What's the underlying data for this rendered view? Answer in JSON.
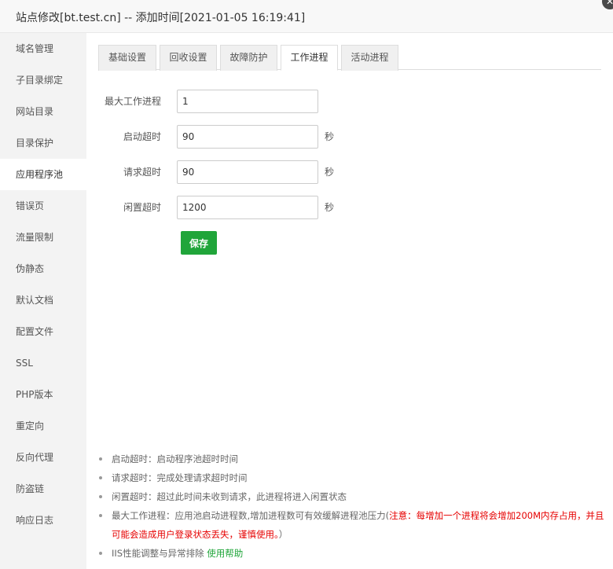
{
  "window": {
    "title": "站点修改[bt.test.cn] -- 添加时间[2021-01-05 16:19:41]",
    "close_glyph": "✕"
  },
  "sidebar": {
    "active_index": 4,
    "items": [
      {
        "label": "域名管理"
      },
      {
        "label": "子目录绑定"
      },
      {
        "label": "网站目录"
      },
      {
        "label": "目录保护"
      },
      {
        "label": "应用程序池"
      },
      {
        "label": "错误页"
      },
      {
        "label": "流量限制"
      },
      {
        "label": "伪静态"
      },
      {
        "label": "默认文档"
      },
      {
        "label": "配置文件"
      },
      {
        "label": "SSL"
      },
      {
        "label": "PHP版本"
      },
      {
        "label": "重定向"
      },
      {
        "label": "反向代理"
      },
      {
        "label": "防盗链"
      },
      {
        "label": "响应日志"
      }
    ]
  },
  "tabs": {
    "active_index": 3,
    "items": [
      {
        "label": "基础设置"
      },
      {
        "label": "回收设置"
      },
      {
        "label": "故障防护"
      },
      {
        "label": "工作进程"
      },
      {
        "label": "活动进程"
      }
    ]
  },
  "form": {
    "max_workers": {
      "label": "最大工作进程",
      "value": "1"
    },
    "startup_timeout": {
      "label": "启动超时",
      "value": "90",
      "unit": "秒"
    },
    "request_timeout": {
      "label": "请求超时",
      "value": "90",
      "unit": "秒"
    },
    "idle_timeout": {
      "label": "闲置超时",
      "value": "1200",
      "unit": "秒"
    },
    "save_label": "保存"
  },
  "help": {
    "startup": "启动超时：启动程序池超时时间",
    "request": "请求超时：完成处理请求超时时间",
    "idle": "闲置超时：超过此时间未收到请求，此进程将进入闲置状态",
    "max_prefix": "最大工作进程：应用池启动进程数,增加进程数可有效缓解进程池压力(",
    "max_warning": "注意：每增加一个进程将会增加200M内存占用，并且可能会造成用户登录状态丢失，谨慎使用。",
    "max_suffix": "）",
    "perf_text": "IIS性能调整与异常排除",
    "perf_link": "使用帮助"
  },
  "colors": {
    "accent_green": "#20a53a",
    "warning_red": "#e60000",
    "sidebar_bg": "#f3f3f3"
  }
}
